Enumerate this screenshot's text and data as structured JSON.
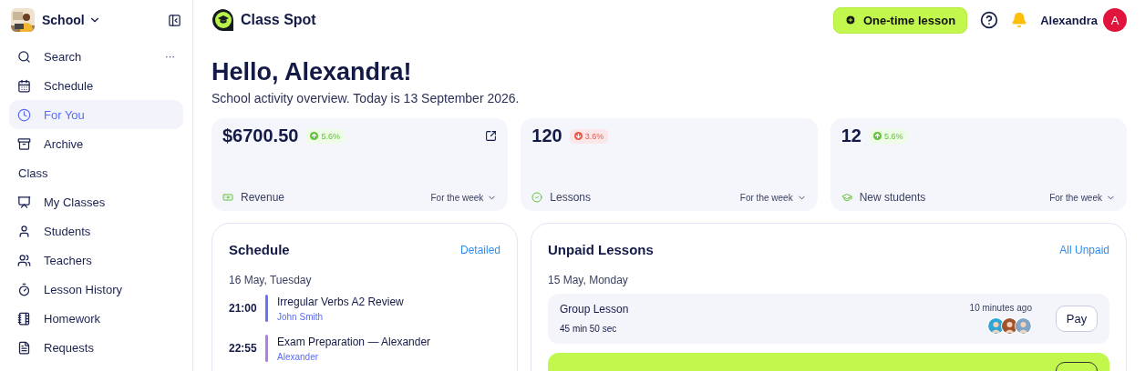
{
  "sidebar": {
    "workspace": {
      "name": "School"
    },
    "items": [
      {
        "kind": "item",
        "label": "Search",
        "selected": false,
        "more": "···"
      },
      {
        "kind": "item",
        "label": "Schedule",
        "selected": false
      },
      {
        "kind": "item",
        "label": "For You",
        "selected": true
      },
      {
        "kind": "item",
        "label": "Archive",
        "selected": false
      },
      {
        "kind": "section",
        "label": "Class"
      },
      {
        "kind": "item",
        "label": "My Classes",
        "selected": false
      },
      {
        "kind": "item",
        "label": "Students",
        "selected": false
      },
      {
        "kind": "item",
        "label": "Teachers",
        "selected": false
      },
      {
        "kind": "item",
        "label": "Lesson History",
        "selected": false
      },
      {
        "kind": "item",
        "label": "Homework",
        "selected": false
      },
      {
        "kind": "item",
        "label": "Requests",
        "selected": false
      }
    ]
  },
  "header": {
    "logo": "Class Spot",
    "action": "One-time lesson",
    "user": "Alexandra",
    "initial": "A"
  },
  "greeting": "Hello, Alexandra!",
  "subtitle": "School activity overview. Today is 13 September 2026.",
  "stats": [
    {
      "value": "$6700.50",
      "change": "5.6%",
      "rising": true,
      "label": "Revenue",
      "period": "For the week",
      "external": true
    },
    {
      "value": "120",
      "change": "3.6%",
      "rising": false,
      "label": "Lessons",
      "period": "For the week",
      "external": false
    },
    {
      "value": "12",
      "change": "5.6%",
      "rising": true,
      "label": "New students",
      "period": "For the week",
      "external": false
    }
  ],
  "schedule": {
    "title": "Schedule",
    "link": "Detailed",
    "date": "16 May, Tuesday",
    "entries": [
      {
        "time": "21:00",
        "title": "Irregular Verbs A2 Review",
        "person": "John Smith",
        "color": "#6a73f5"
      },
      {
        "time": "22:55",
        "title": "Exam Preparation — Alexander",
        "person": "Alexander",
        "color": "#b07de0"
      }
    ]
  },
  "unpaid": {
    "title": "Unpaid Lessons",
    "link": "All Unpaid",
    "date": "15 May, Monday",
    "lessons": [
      {
        "title": "Group Lesson",
        "duration": "45 min 50 sec",
        "time": "10 minutes ago",
        "highlighted": false,
        "button": "Pay",
        "avatars": [
          {
            "color": "#2fa6d8"
          },
          {
            "color": "#a0522d"
          },
          {
            "color": "#7fa6c8"
          }
        ]
      },
      {
        "highlighted": true
      }
    ]
  }
}
